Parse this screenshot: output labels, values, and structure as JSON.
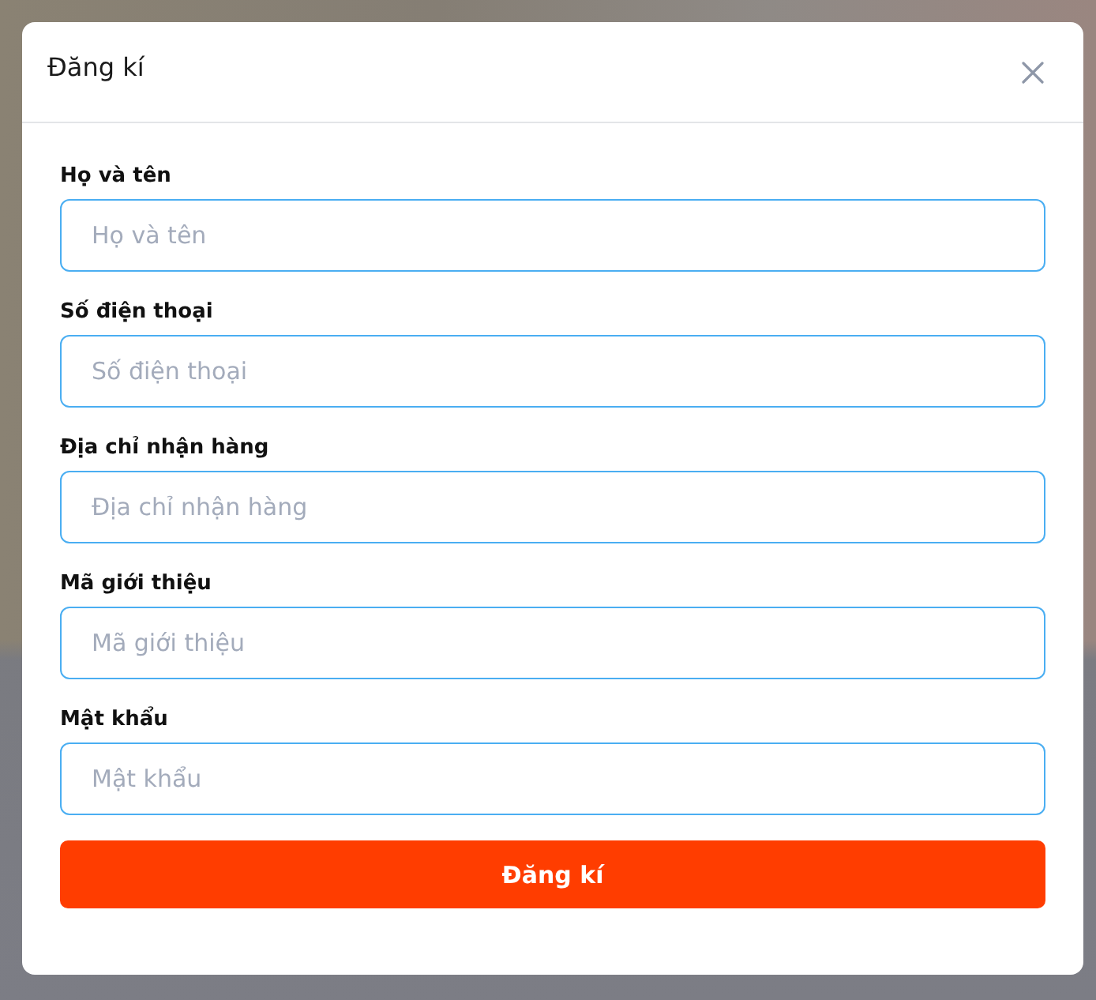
{
  "dialog": {
    "title": "Đăng kí"
  },
  "fields": [
    {
      "label": "Họ và tên",
      "placeholder": "Họ và tên"
    },
    {
      "label": "Số điện thoại",
      "placeholder": "Số điện thoại"
    },
    {
      "label": "Địa chỉ nhận hàng",
      "placeholder": "Địa chỉ nhận hàng"
    },
    {
      "label": "Mã giới thiệu",
      "placeholder": "Mã giới thiệu"
    },
    {
      "label": "Mật khẩu",
      "placeholder": "Mật khẩu"
    }
  ],
  "submit_button": {
    "label": "Đăng kí"
  }
}
